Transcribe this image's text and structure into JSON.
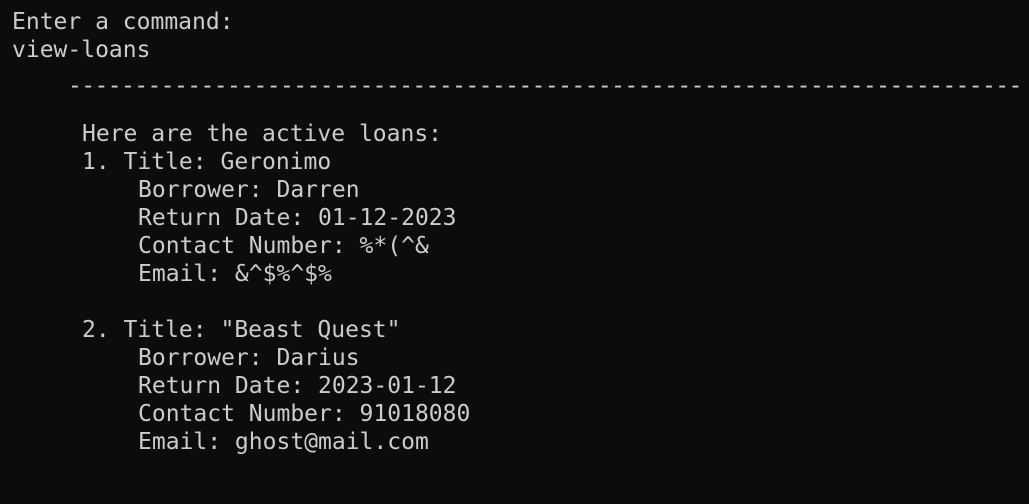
{
  "colors": {
    "background": "#0c0c0c",
    "text": "#cccccc"
  },
  "terminal": {
    "prompt": "Enter a command:",
    "input": "view-loans",
    "divider": "------------------------------------------------------------------------",
    "heading": "Here are the active loans:",
    "loans": [
      {
        "title": "1. Title: Geronimo",
        "borrower": "Borrower: Darren",
        "return_date": "Return Date: 01-12-2023",
        "contact": "Contact Number: %*(^&",
        "email": "Email: &^$%^$%"
      },
      {
        "title": "2. Title: \"Beast Quest\"",
        "borrower": "Borrower: Darius",
        "return_date": "Return Date: 2023-01-12",
        "contact": "Contact Number: 91018080",
        "email": "Email: ghost@mail.com"
      }
    ]
  }
}
